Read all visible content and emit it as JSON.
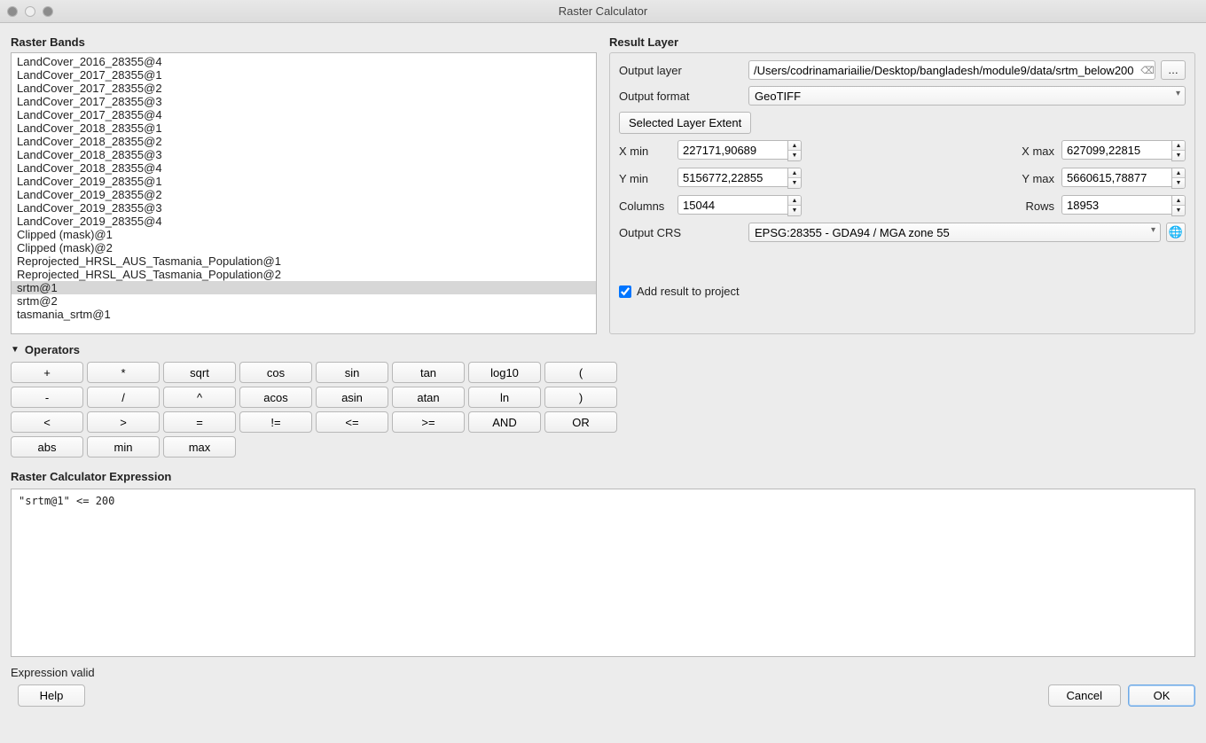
{
  "window": {
    "title": "Raster Calculator"
  },
  "bands": {
    "label": "Raster Bands",
    "selected_index": 19,
    "items": [
      "LandCover_2016_28355@4",
      "LandCover_2017_28355@1",
      "LandCover_2017_28355@2",
      "LandCover_2017_28355@3",
      "LandCover_2017_28355@4",
      "LandCover_2018_28355@1",
      "LandCover_2018_28355@2",
      "LandCover_2018_28355@3",
      "LandCover_2018_28355@4",
      "LandCover_2019_28355@1",
      "LandCover_2019_28355@2",
      "LandCover_2019_28355@3",
      "LandCover_2019_28355@4",
      "Clipped (mask)@1",
      "Clipped (mask)@2",
      "Reprojected_HRSL_AUS_Tasmania_Population@1",
      "Reprojected_HRSL_AUS_Tasmania_Population@2",
      "srtm@1",
      "srtm@2",
      "tasmania_srtm@1"
    ]
  },
  "result": {
    "label": "Result Layer",
    "output_layer_label": "Output layer",
    "output_layer_value": "/Users/codrinamariailie/Desktop/bangladesh/module9/data/srtm_below200",
    "browse_label": "…",
    "output_format_label": "Output format",
    "output_format_value": "GeoTIFF",
    "extent_button": "Selected Layer Extent",
    "xmin_label": "X min",
    "xmin": "227171,90689",
    "xmax_label": "X max",
    "xmax": "627099,22815",
    "ymin_label": "Y min",
    "ymin": "5156772,22855",
    "ymax_label": "Y max",
    "ymax": "5660615,78877",
    "cols_label": "Columns",
    "cols": "15044",
    "rows_label": "Rows",
    "rows": "18953",
    "crs_label": "Output CRS",
    "crs_value": "EPSG:28355 - GDA94 / MGA zone 55",
    "add_to_project_label": "Add result to project",
    "add_to_project_checked": true
  },
  "operators": {
    "label": "Operators",
    "rows": [
      [
        "+",
        "*",
        "sqrt",
        "cos",
        "sin",
        "tan",
        "log10",
        "("
      ],
      [
        "-",
        "/",
        "^",
        "acos",
        "asin",
        "atan",
        "ln",
        ")"
      ],
      [
        "<",
        ">",
        "=",
        "!=",
        "<=",
        ">=",
        "AND",
        "OR"
      ],
      [
        "abs",
        "min",
        "max"
      ]
    ]
  },
  "expression": {
    "label": "Raster Calculator Expression",
    "value": "\"srtm@1\" <= 200"
  },
  "status": "Expression valid",
  "buttons": {
    "help": "Help",
    "cancel": "Cancel",
    "ok": "OK"
  }
}
